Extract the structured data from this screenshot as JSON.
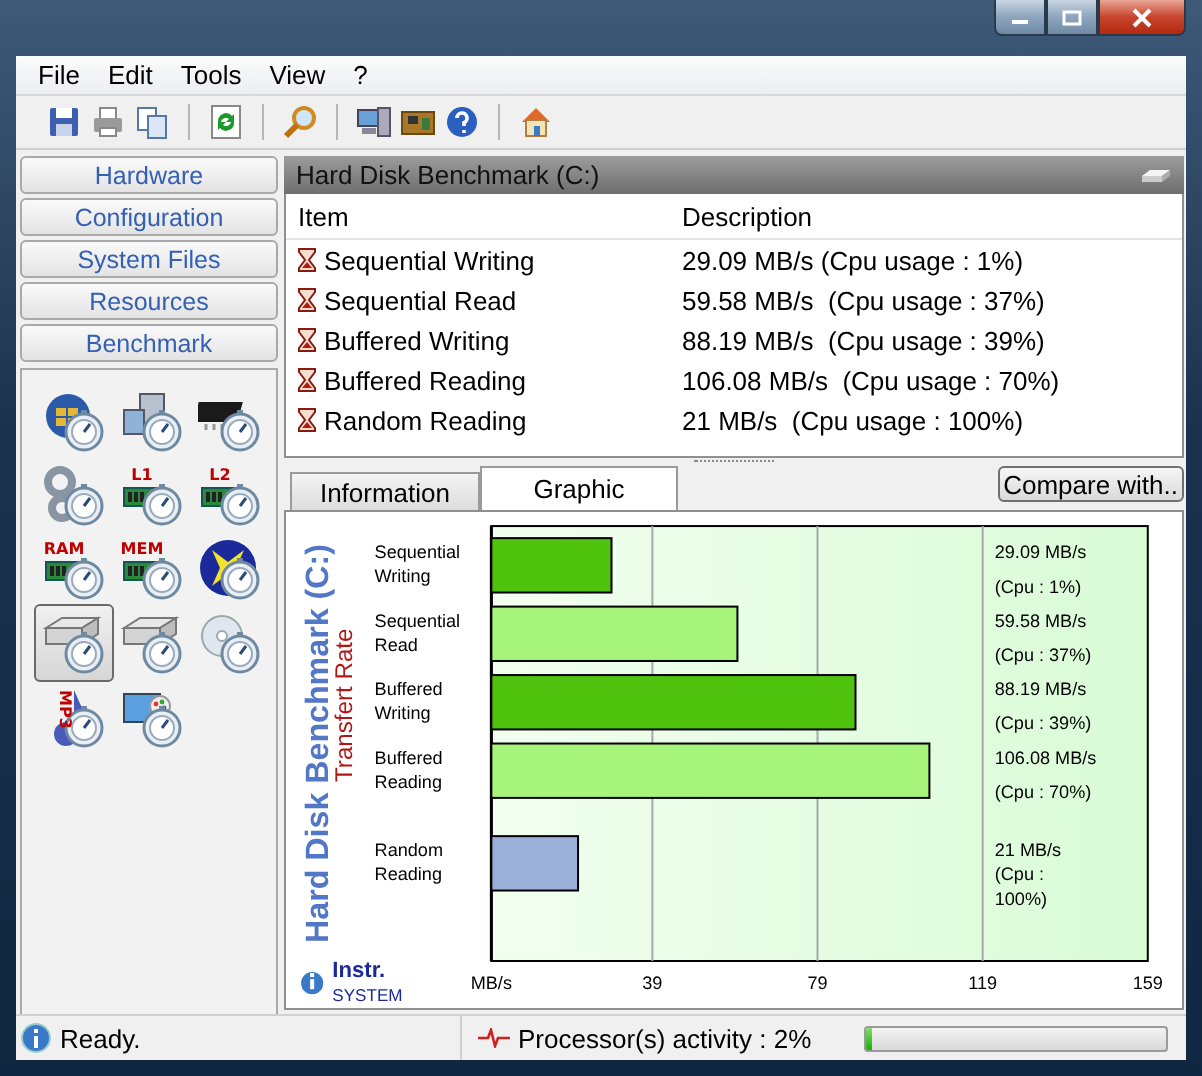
{
  "menu": [
    "File",
    "Edit",
    "Tools",
    "View",
    "?"
  ],
  "toolbar": [
    {
      "kind": "save"
    },
    {
      "kind": "print"
    },
    {
      "kind": "copy"
    },
    {
      "kind": "separator"
    },
    {
      "kind": "refresh"
    },
    {
      "kind": "separator"
    },
    {
      "kind": "search"
    },
    {
      "kind": "separator"
    },
    {
      "kind": "computer"
    },
    {
      "kind": "board"
    },
    {
      "kind": "help"
    },
    {
      "kind": "separator"
    },
    {
      "kind": "home"
    }
  ],
  "sidebar": {
    "sections": [
      {
        "label": "Hardware"
      },
      {
        "label": "Configuration"
      },
      {
        "label": "System Files"
      },
      {
        "label": "Resources"
      },
      {
        "label": "Benchmark"
      }
    ],
    "tools": [
      {
        "kind": "orb",
        "selected": false
      },
      {
        "kind": "computer",
        "selected": false
      },
      {
        "kind": "chip",
        "selected": false
      },
      {
        "kind": "gears",
        "selected": false
      },
      {
        "kind": "memory",
        "badge": "L1",
        "selected": false
      },
      {
        "kind": "memory",
        "badge": "L2",
        "selected": false
      },
      {
        "kind": "memory",
        "badge": "RAM",
        "selected": false
      },
      {
        "kind": "memory",
        "badge": "MEM",
        "selected": false
      },
      {
        "kind": "cross",
        "selected": false
      },
      {
        "kind": "drive",
        "selected": true
      },
      {
        "kind": "drive",
        "selected": false
      },
      {
        "kind": "disc",
        "selected": false
      },
      {
        "kind": "note",
        "badge": "MP3",
        "selected": false
      },
      {
        "kind": "monitor",
        "selected": false
      }
    ]
  },
  "panel": {
    "title": "Hard Disk Benchmark (C:)",
    "table": {
      "columns": [
        "Item",
        "Description"
      ],
      "rows": [
        {
          "item": "Sequential Writing",
          "description": "29.09 MB/s (Cpu usage : 1%)"
        },
        {
          "item": "Sequential Read",
          "description": "59.58 MB/s  (Cpu usage : 37%)"
        },
        {
          "item": "Buffered Writing",
          "description": "88.19 MB/s  (Cpu usage : 39%)"
        },
        {
          "item": "Buffered Reading",
          "description": "106.08 MB/s  (Cpu usage : 70%)"
        },
        {
          "item": "Random Reading",
          "description": "21 MB/s  (Cpu usage : 100%)"
        }
      ]
    },
    "tabs": [
      {
        "label": "Information",
        "selected": false
      },
      {
        "label": "Graphic",
        "selected": true
      }
    ],
    "compare_button": "Compare with..",
    "graph": {
      "brand": {
        "name": "Instr.",
        "sub": "SYSTEM"
      },
      "chart_data": {
        "type": "bar",
        "orientation": "horizontal",
        "stacked": true,
        "title": "Hard Disk Benchmark (C:)",
        "ylabel": "Transfert Rate",
        "categories": [
          "Sequential Writing",
          "Sequential Read",
          "Buffered Writing",
          "Buffered Reading",
          "Random Reading"
        ],
        "series": [
          {
            "color": "#4fc30d",
            "values": [
              29.1,
              null,
              88.2,
              null,
              null
            ]
          },
          {
            "color": "#a6f57a",
            "values": [
              null,
              59.6,
              null,
              106.1,
              null
            ]
          },
          {
            "color": "#9bb0d8",
            "values": [
              null,
              null,
              null,
              null,
              21
            ]
          }
        ],
        "xlim": [
          0,
          159
        ],
        "grid": true,
        "xticks": [
          {
            "value": 0,
            "label": "MB/s"
          },
          39,
          79,
          119,
          159
        ],
        "value_labels": [
          [
            "29.09  MB/s",
            "(Cpu : 1%)"
          ],
          [
            "59.58  MB/s",
            "(Cpu : 37%)"
          ],
          [
            "88.19  MB/s",
            "(Cpu : 39%)"
          ],
          [
            "106.08  MB/s",
            "(Cpu : 70%)"
          ],
          [
            "21 MB/s",
            "(Cpu :",
            "100%)"
          ]
        ]
      }
    }
  },
  "status": {
    "message": "Ready.",
    "activity": {
      "label": "Processor(s) activity : 2%",
      "level": 0.02
    }
  }
}
